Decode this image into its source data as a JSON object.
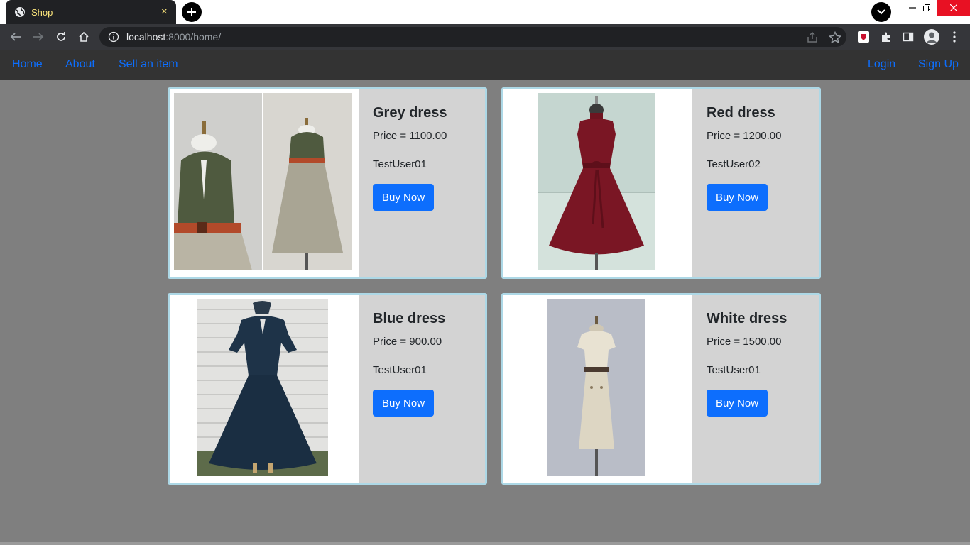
{
  "browser": {
    "tab_title": "Shop",
    "tab_close": "×",
    "url_host": "localhost",
    "url_rest": ":8000/home/"
  },
  "nav": {
    "home": "Home",
    "about": "About",
    "sell": "Sell an item",
    "login": "Login",
    "signup": "Sign Up",
    "link_color": "#0d6efd",
    "bg_color": "#333333"
  },
  "products": [
    {
      "name": "Grey dress",
      "price": "Price = 1100.00",
      "seller": "TestUser01",
      "button": "Buy Now",
      "image_icon": "grey-dress-photo"
    },
    {
      "name": "Red dress",
      "price": "Price = 1200.00",
      "seller": "TestUser02",
      "button": "Buy Now",
      "image_icon": "red-dress-photo"
    },
    {
      "name": "Blue dress",
      "price": "Price = 900.00",
      "seller": "TestUser01",
      "button": "Buy Now",
      "image_icon": "blue-dress-photo"
    },
    {
      "name": "White dress",
      "price": "Price = 1500.00",
      "seller": "TestUser01",
      "button": "Buy Now",
      "image_icon": "white-dress-photo"
    }
  ],
  "colors": {
    "page_bg": "#7f7f7f",
    "card_border": "#add8e6",
    "card_bg": "#d3d3d3",
    "button_bg": "#0d6efd"
  }
}
